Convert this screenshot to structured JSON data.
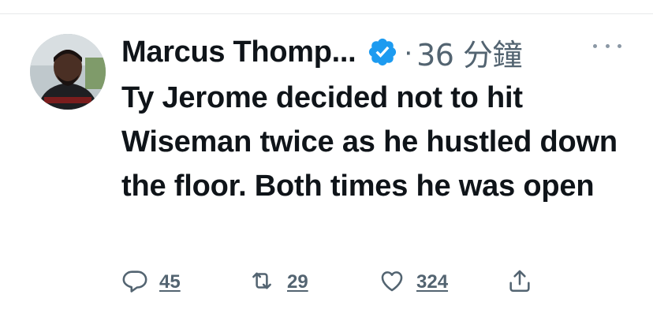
{
  "tweet": {
    "author_name": "Marcus Thomp...",
    "separator": "·",
    "time": "36 分鐘",
    "text": "Ty Jerome decided not to hit Wiseman twice as he hustled down the floor. Both times he was open"
  },
  "actions": {
    "reply_count": "45",
    "retweet_count": "29",
    "like_count": "324"
  },
  "colors": {
    "verified_badge": "#1d9bf0",
    "muted_text": "#536471",
    "primary_text": "#0f1419"
  },
  "icons": [
    "verified-badge-icon",
    "more-icon",
    "reply-icon",
    "retweet-icon",
    "like-icon",
    "share-icon"
  ]
}
